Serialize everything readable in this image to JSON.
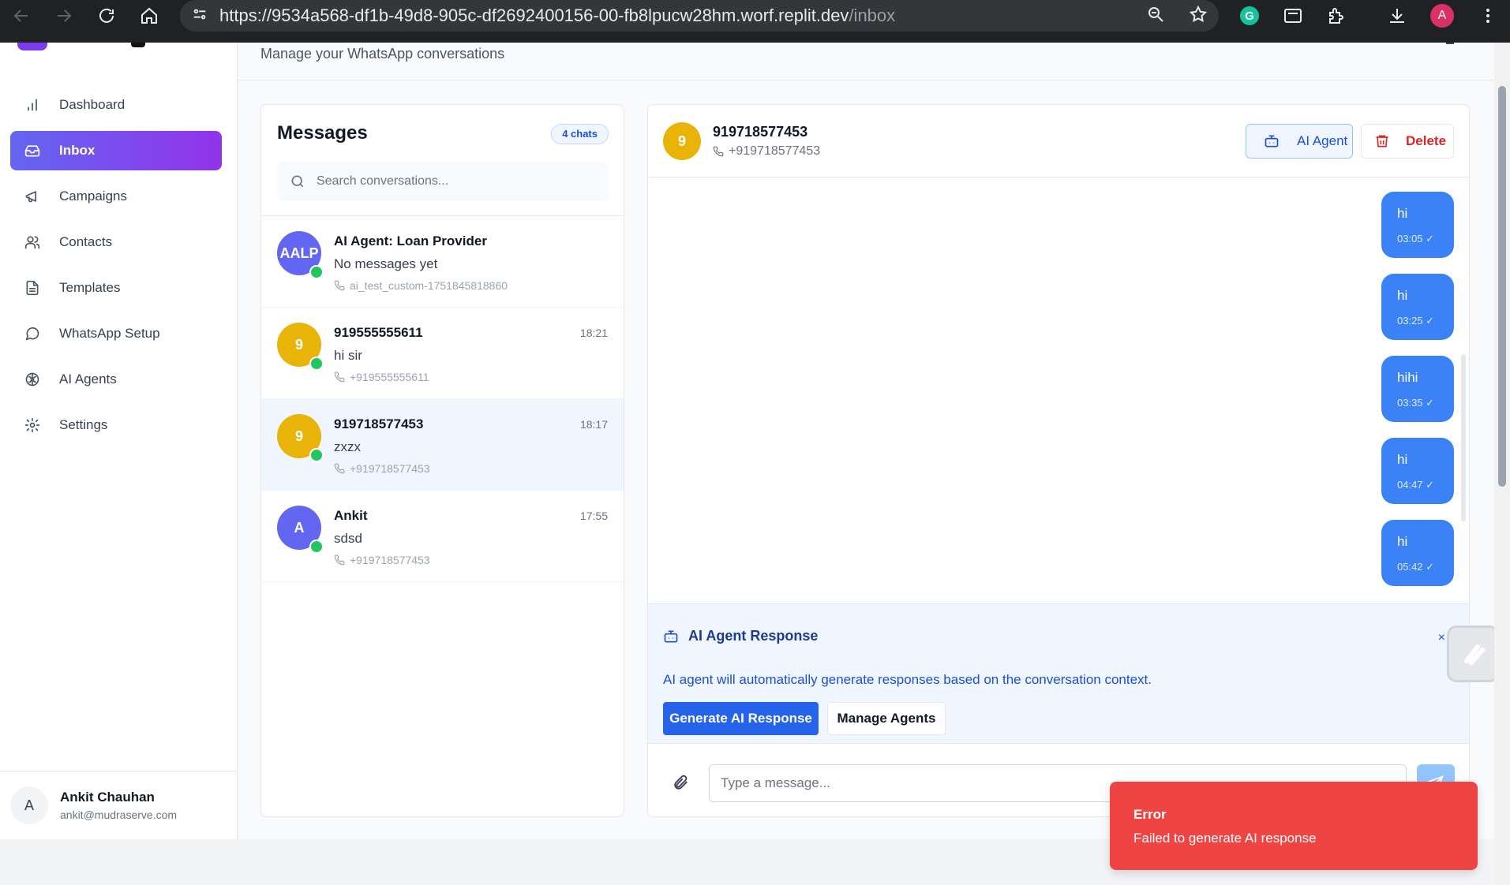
{
  "browser": {
    "url_main": "https://9534a568-df1b-49d8-905c-df2692400156-00-fb8lpucw28hm.worf.replit.dev",
    "url_path": "/inbox",
    "profile_initial": "A"
  },
  "header": {
    "subtitle": "Manage your WhatsApp conversations"
  },
  "sidebar": {
    "items": [
      {
        "label": "Dashboard",
        "icon": "bar-chart-icon"
      },
      {
        "label": "Inbox",
        "icon": "inbox-icon"
      },
      {
        "label": "Campaigns",
        "icon": "megaphone-icon"
      },
      {
        "label": "Contacts",
        "icon": "users-icon"
      },
      {
        "label": "Templates",
        "icon": "file-text-icon"
      },
      {
        "label": "WhatsApp Setup",
        "icon": "message-circle-icon"
      },
      {
        "label": "AI Agents",
        "icon": "brain-icon"
      },
      {
        "label": "Settings",
        "icon": "gear-icon"
      }
    ],
    "active_index": 1,
    "user": {
      "initial": "A",
      "name": "Ankit Chauhan",
      "email": "ankit@mudraserve.com"
    }
  },
  "messages": {
    "title": "Messages",
    "count_badge": "4 chats",
    "search_placeholder": "Search conversations...",
    "conversations": [
      {
        "initials": "AALP",
        "name": "AI Agent: Loan Provider",
        "time": "",
        "last": "No messages yet",
        "phone": "ai_test_custom-1751845818860",
        "color": "#6366f1",
        "selected": false
      },
      {
        "initials": "9",
        "name": "919555555611",
        "time": "18:21",
        "last": "hi sir",
        "phone": "+919555555611",
        "color": "#eab308",
        "selected": false
      },
      {
        "initials": "9",
        "name": "919718577453",
        "time": "18:17",
        "last": "zxzx",
        "phone": "+919718577453",
        "color": "#eab308",
        "selected": true
      },
      {
        "initials": "A",
        "name": "Ankit",
        "time": "17:55",
        "last": "sdsd",
        "phone": "+919718577453",
        "color": "#6366f1",
        "selected": false
      }
    ]
  },
  "chat": {
    "avatar_initial": "9",
    "contact_name": "919718577453",
    "contact_phone": "+919718577453",
    "ai_agent_label": "AI Agent",
    "delete_label": "Delete",
    "bubbles": [
      {
        "text": "hi",
        "time": "03:05"
      },
      {
        "text": "hi",
        "time": "03:25"
      },
      {
        "text": "hihi",
        "time": "03:35"
      },
      {
        "text": "hi",
        "time": "04:47"
      },
      {
        "text": "hi",
        "time": "05:42"
      }
    ],
    "ai_panel": {
      "title": "AI Agent Response",
      "close": "×",
      "description": "AI agent will automatically generate responses based on the conversation context.",
      "generate_label": "Generate AI Response",
      "manage_label": "Manage Agents"
    },
    "composer_placeholder": "Type a message..."
  },
  "toast": {
    "title": "Error",
    "description": "Failed to generate AI response"
  }
}
